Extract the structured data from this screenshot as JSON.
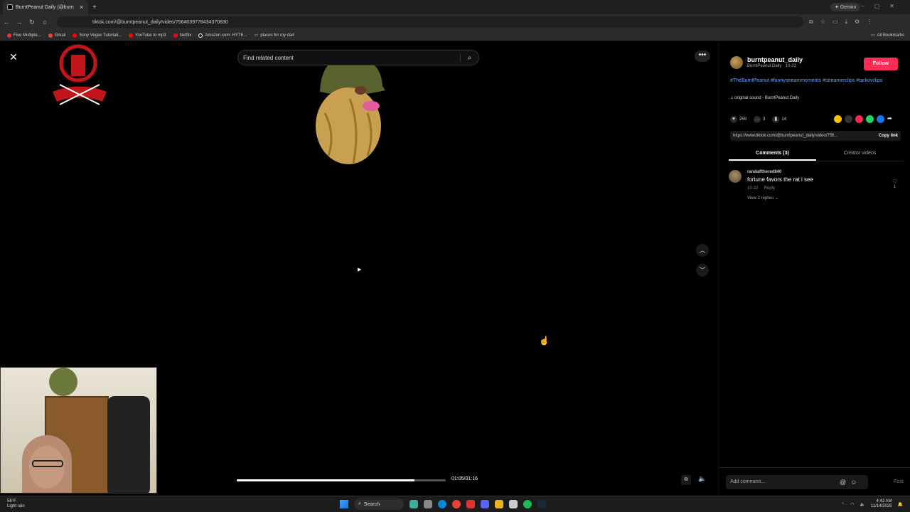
{
  "browser": {
    "tab_title": "BurntPeanut Daily (@burn",
    "gemini_label": "✦ Gemini",
    "url": "tiktok.com/@burntpeanut_daily/video/7564039778434370830",
    "bookmarks": [
      "Five Multiple...",
      "Gmail",
      "Sony Vegas Tutoriali...",
      "YouTube to mp3",
      "Netflix",
      "Amazon.com: HYTE...",
      "places for my dad"
    ],
    "all_bookmarks": "All Bookmarks"
  },
  "video": {
    "search_placeholder": "Find related content",
    "time": "01:05/01:16",
    "progress_fraction": 0.85
  },
  "panel": {
    "username": "burntpeanut_daily",
    "subtitle": "BurntPeanut Daily · 10-22",
    "follow_label": "Follow",
    "hashtags": "#TheBurntPeanut #funnystreammoments #streamerclips #tarkovclips",
    "sound": "♫ original sound - BurntPeanut Daily",
    "likes": "259",
    "comments_count": "3",
    "saves": "14",
    "link": "https://www.tiktok.com/@burntpeanut_daily/video/756...",
    "copy_link": "Copy link",
    "tab_comments": "Comments (3)",
    "tab_creator": "Creator videos",
    "comment": {
      "user": "randalfthered840",
      "text": "fortune favors the rat i see",
      "date": "10-22",
      "reply": "Reply",
      "view_replies": "View 2 replies ⌄",
      "likes": "1"
    },
    "add_comment_placeholder": "Add comment...",
    "post_label": "Post"
  },
  "taskbar": {
    "weather_temp": "56°F",
    "weather_desc": "Light rain",
    "search_label": "Search",
    "time": "4:42 AM",
    "date": "11/14/2025"
  },
  "colors": {
    "accent": "#fe2c55",
    "hashtag": "#6aa6ff"
  }
}
